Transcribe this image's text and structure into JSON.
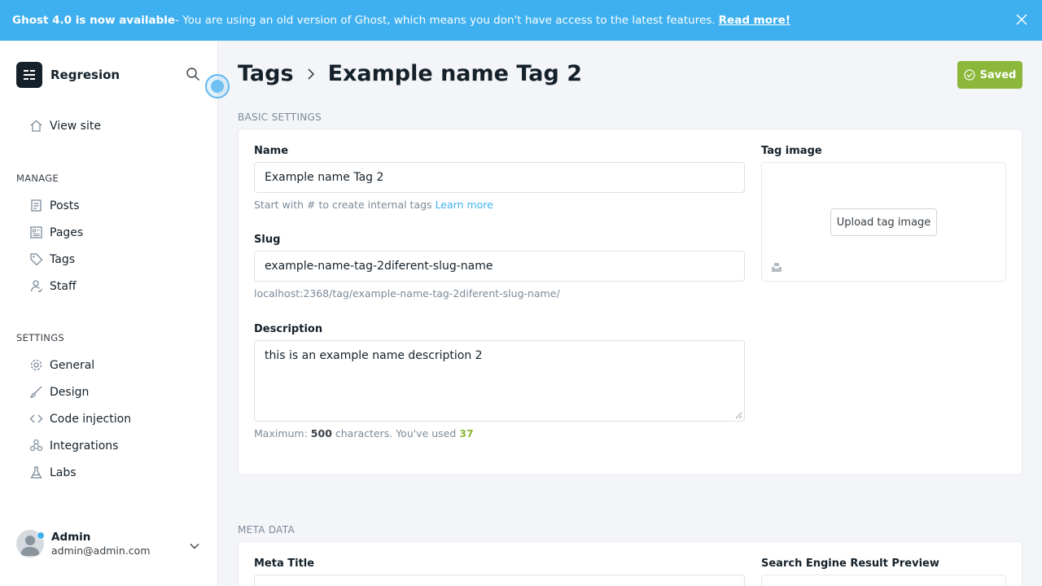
{
  "banner": {
    "headline": "Ghost 4.0 is now available",
    "message": " - You are using an old version of Ghost, which means you don't have access to the latest features.",
    "link": "Read more!"
  },
  "sidebar": {
    "site_name": "Regresion",
    "view_site": "View site",
    "manage_heading": "MANAGE",
    "manage_items": [
      {
        "label": "Posts",
        "icon": "posts-icon"
      },
      {
        "label": "Pages",
        "icon": "pages-icon"
      },
      {
        "label": "Tags",
        "icon": "tag-icon"
      },
      {
        "label": "Staff",
        "icon": "staff-icon"
      }
    ],
    "settings_heading": "SETTINGS",
    "settings_items": [
      {
        "label": "General",
        "icon": "gear-icon"
      },
      {
        "label": "Design",
        "icon": "brush-icon"
      },
      {
        "label": "Code injection",
        "icon": "code-icon"
      },
      {
        "label": "Integrations",
        "icon": "integrations-icon"
      },
      {
        "label": "Labs",
        "icon": "flask-icon"
      }
    ],
    "user": {
      "name": "Admin",
      "email": "admin@admin.com"
    }
  },
  "header": {
    "crumb_parent": "Tags",
    "crumb_current": "Example name Tag 2",
    "saved_label": "Saved"
  },
  "basic": {
    "section_title": "BASIC SETTINGS",
    "name_label": "Name",
    "name_value": "Example name Tag 2",
    "name_hint": "Start with # to create internal tags",
    "name_hint_link": "Learn more",
    "slug_label": "Slug",
    "slug_value": "example-name-tag-2diferent-slug-name",
    "slug_url": "localhost:2368/tag/example-name-tag-2diferent-slug-name/",
    "description_label": "Description",
    "description_value": "this is an example name description 2",
    "desc_hint_prefix": "Maximum:",
    "desc_max": "500",
    "desc_hint_mid": "characters. You've used",
    "desc_used": "37",
    "tag_image_label": "Tag image",
    "upload_label": "Upload tag image"
  },
  "meta": {
    "section_title": "META DATA",
    "meta_title_label": "Meta Title",
    "preview_label": "Search Engine Result Preview"
  },
  "colors": {
    "banner": "#3eb0ef",
    "saved": "#8bb83b",
    "link": "#3eb0ef"
  }
}
